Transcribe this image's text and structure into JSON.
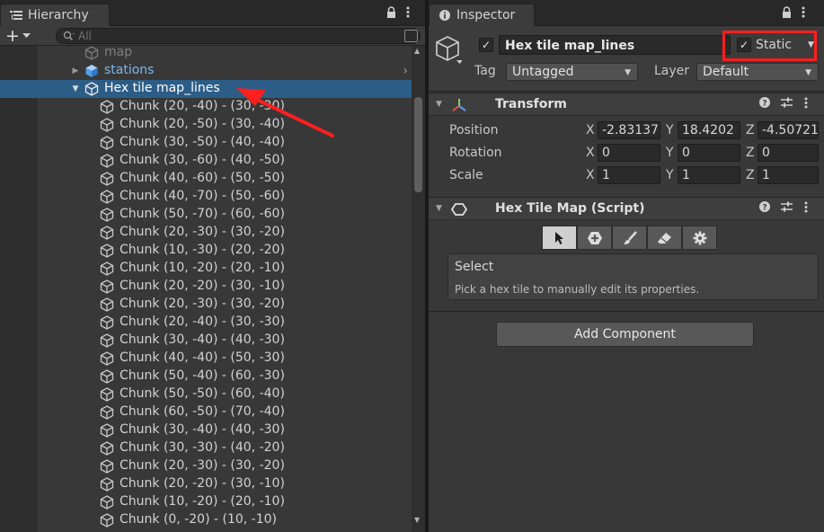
{
  "hierarchy": {
    "tab_label": "Hierarchy",
    "search_placeholder": "All",
    "rows": [
      {
        "label": "map",
        "kind": "faded",
        "indent": 1
      },
      {
        "label": "stations",
        "kind": "prefab",
        "indent": 1,
        "expander": "collapsed",
        "has_chevron": true
      },
      {
        "label": "Hex tile map_lines",
        "kind": "selected",
        "indent": 1,
        "expander": "expanded"
      },
      {
        "label": "Chunk (20, -40) - (30, -30)",
        "kind": "child",
        "indent": 2
      },
      {
        "label": "Chunk (20, -50) - (30, -40)",
        "kind": "child",
        "indent": 2
      },
      {
        "label": "Chunk (30, -50) - (40, -40)",
        "kind": "child",
        "indent": 2
      },
      {
        "label": "Chunk (30, -60) - (40, -50)",
        "kind": "child",
        "indent": 2
      },
      {
        "label": "Chunk (40, -60) - (50, -50)",
        "kind": "child",
        "indent": 2
      },
      {
        "label": "Chunk (40, -70) - (50, -60)",
        "kind": "child",
        "indent": 2
      },
      {
        "label": "Chunk (50, -70) - (60, -60)",
        "kind": "child",
        "indent": 2
      },
      {
        "label": "Chunk (20, -30) - (30, -20)",
        "kind": "child",
        "indent": 2
      },
      {
        "label": "Chunk (10, -30) - (20, -20)",
        "kind": "child",
        "indent": 2
      },
      {
        "label": "Chunk (10, -20) - (20, -10)",
        "kind": "child",
        "indent": 2
      },
      {
        "label": "Chunk (20, -20) - (30, -10)",
        "kind": "child",
        "indent": 2
      },
      {
        "label": "Chunk (20, -30) - (30, -20)",
        "kind": "child",
        "indent": 2
      },
      {
        "label": "Chunk (20, -40) - (30, -30)",
        "kind": "child",
        "indent": 2
      },
      {
        "label": "Chunk (30, -40) - (40, -30)",
        "kind": "child",
        "indent": 2
      },
      {
        "label": "Chunk (40, -40) - (50, -30)",
        "kind": "child",
        "indent": 2
      },
      {
        "label": "Chunk (50, -40) - (60, -30)",
        "kind": "child",
        "indent": 2
      },
      {
        "label": "Chunk (50, -50) - (60, -40)",
        "kind": "child",
        "indent": 2
      },
      {
        "label": "Chunk (60, -50) - (70, -40)",
        "kind": "child",
        "indent": 2
      },
      {
        "label": "Chunk (30, -40) - (40, -30)",
        "kind": "child",
        "indent": 2
      },
      {
        "label": "Chunk (30, -30) - (40, -20)",
        "kind": "child",
        "indent": 2
      },
      {
        "label": "Chunk (20, -30) - (30, -20)",
        "kind": "child",
        "indent": 2
      },
      {
        "label": "Chunk (20, -20) - (30, -10)",
        "kind": "child",
        "indent": 2
      },
      {
        "label": "Chunk (10, -20) - (20, -10)",
        "kind": "child",
        "indent": 2
      },
      {
        "label": "Chunk (0, -20) - (10, -10)",
        "kind": "child",
        "indent": 2
      }
    ]
  },
  "inspector": {
    "tab_label": "Inspector",
    "object_name": "Hex tile map_lines",
    "active": true,
    "static_label": "Static",
    "static_checked": true,
    "tag_label": "Tag",
    "tag_value": "Untagged",
    "layer_label": "Layer",
    "layer_value": "Default",
    "transform": {
      "title": "Transform",
      "position_label": "Position",
      "rotation_label": "Rotation",
      "scale_label": "Scale",
      "axis_x": "X",
      "axis_y": "Y",
      "axis_z": "Z",
      "position": {
        "x": "-2.83137",
        "y": "18.4202",
        "z": "-4.50721"
      },
      "rotation": {
        "x": "0",
        "y": "0",
        "z": "0"
      },
      "scale": {
        "x": "1",
        "y": "1",
        "z": "1"
      }
    },
    "hex_script": {
      "title": "Hex Tile Map (Script)",
      "tools": [
        "select-tool",
        "paint-hex-tool",
        "brush-tool",
        "eraser-tool",
        "settings-tool"
      ],
      "active_tool": 0,
      "mode_title": "Select",
      "mode_desc": "Pick a hex tile to manually edit its properties."
    },
    "add_component_label": "Add Component"
  },
  "colors": {
    "selection": "#2c5d87",
    "prefab_text": "#7cb8f0",
    "annotation_red": "#ff1f1f"
  }
}
